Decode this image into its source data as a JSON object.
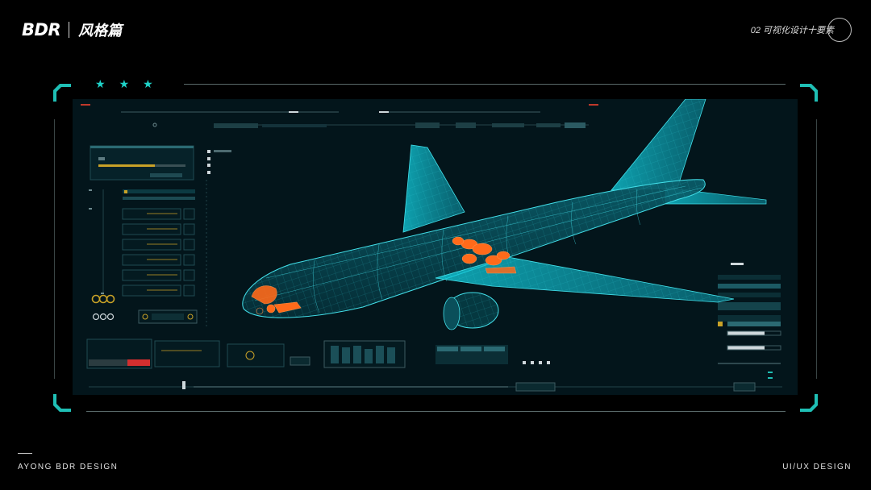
{
  "header": {
    "logo": "BDR",
    "subtitle": "风格篇",
    "section": "02 可视化设计十要素"
  },
  "footer": {
    "left": "AYONG BDR DESIGN",
    "right": "UI/UX DESIGN"
  },
  "frame": {
    "stars": [
      "★",
      "★",
      "★"
    ],
    "accent_color": "#1fd3c9"
  },
  "screen": {
    "background": "#03151b",
    "wire_color": "#2fd0dc",
    "highlight_color": "#ff6a1a"
  }
}
